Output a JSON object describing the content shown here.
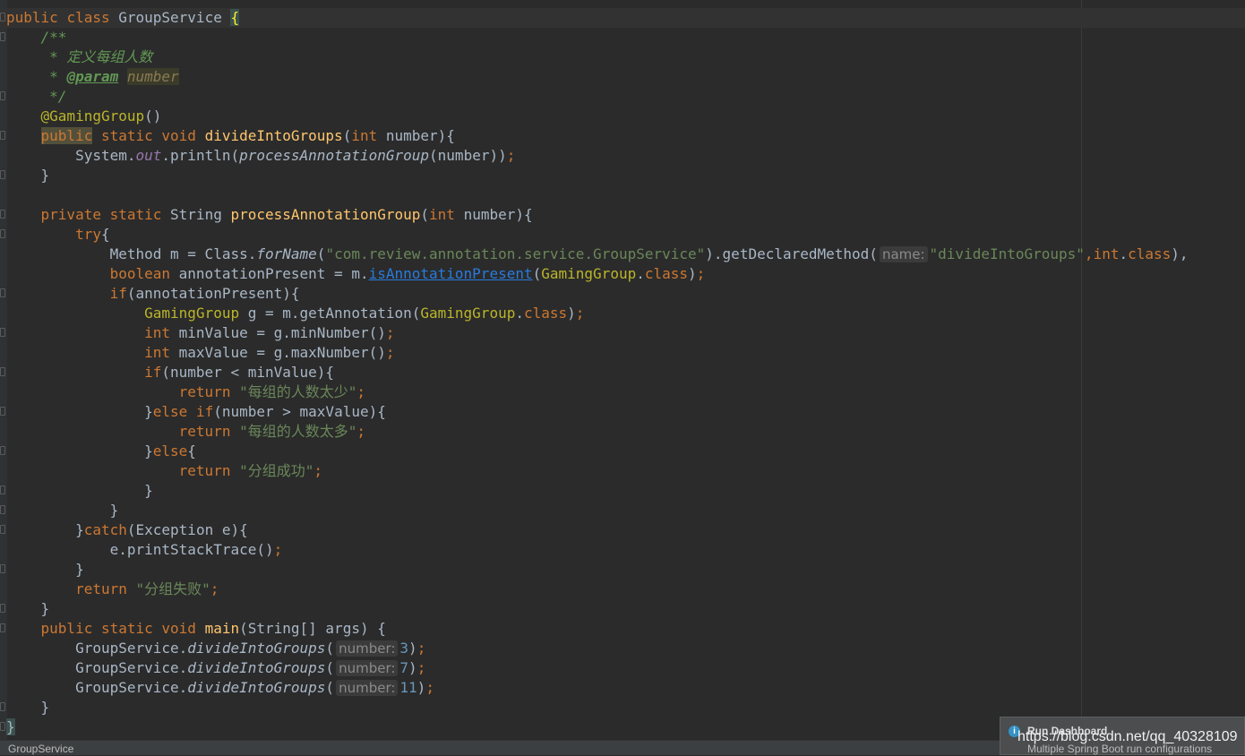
{
  "editor": {
    "lines": [
      {
        "tokens": [
          [
            "kw",
            "public "
          ],
          [
            "kw",
            "class "
          ],
          [
            "",
            "GroupService "
          ],
          [
            "brace-hl",
            "{"
          ]
        ]
      },
      {
        "tokens": [
          [
            "cmt",
            "    /**"
          ]
        ]
      },
      {
        "tokens": [
          [
            "cmt",
            "     * 定义每组人数"
          ]
        ]
      },
      {
        "tokens": [
          [
            "cmt",
            "     * "
          ],
          [
            "tag",
            "@param"
          ],
          [
            "cmt",
            " "
          ],
          [
            "tagval",
            "number"
          ]
        ]
      },
      {
        "tokens": [
          [
            "cmt",
            "     */"
          ]
        ]
      },
      {
        "tokens": [
          [
            "ann",
            "    @GamingGroup"
          ],
          [
            "",
            "()"
          ]
        ]
      },
      {
        "tokens": [
          [
            "",
            "    "
          ],
          [
            "kwhl",
            "public"
          ],
          [
            "kw",
            " static void "
          ],
          [
            "mth",
            "divideIntoGroups"
          ],
          [
            "",
            "("
          ],
          [
            "kw",
            "int "
          ],
          [
            "",
            "number){"
          ]
        ]
      },
      {
        "tokens": [
          [
            "",
            "        System."
          ],
          [
            "fld",
            "out"
          ],
          [
            "",
            ".println("
          ],
          [
            "ital",
            "processAnnotationGroup"
          ],
          [
            "",
            "(number))"
          ],
          [
            "kw",
            ";"
          ]
        ]
      },
      {
        "tokens": [
          [
            "",
            "    }"
          ]
        ]
      },
      {
        "tokens": [
          [
            "",
            ""
          ]
        ]
      },
      {
        "tokens": [
          [
            "kw",
            "    private static "
          ],
          [
            "",
            "String "
          ],
          [
            "mth",
            "processAnnotationGroup"
          ],
          [
            "",
            "("
          ],
          [
            "kw",
            "int "
          ],
          [
            "",
            "number){"
          ]
        ]
      },
      {
        "tokens": [
          [
            "kw",
            "        try"
          ],
          [
            "",
            "{"
          ]
        ]
      },
      {
        "tokens": [
          [
            "",
            "            Method m = Class."
          ],
          [
            "ital",
            "forName"
          ],
          [
            "",
            "("
          ],
          [
            "str",
            "\"com.review.annotation.service.GroupService\""
          ],
          [
            "",
            ").getDeclaredMethod("
          ],
          [
            "hint",
            "name:"
          ],
          [
            "str",
            "\"divideIntoGroups\""
          ],
          [
            "kw",
            ","
          ],
          [
            "kw",
            "int"
          ],
          [
            "",
            "."
          ],
          [
            "kw",
            "class"
          ],
          [
            "",
            "),"
          ]
        ]
      },
      {
        "tokens": [
          [
            "kw",
            "            boolean "
          ],
          [
            "",
            "annotationPresent = m."
          ],
          [
            "link",
            "isAnnotationPresent"
          ],
          [
            "",
            "("
          ],
          [
            "ann",
            "GamingGroup"
          ],
          [
            "",
            "."
          ],
          [
            "kw",
            "class"
          ],
          [
            "",
            ")"
          ],
          [
            "kw",
            ";"
          ]
        ]
      },
      {
        "tokens": [
          [
            "kw",
            "            if"
          ],
          [
            "",
            "(annotationPresent){"
          ]
        ]
      },
      {
        "tokens": [
          [
            "ann",
            "                GamingGroup "
          ],
          [
            "",
            "g = m.getAnnotation("
          ],
          [
            "ann",
            "GamingGroup"
          ],
          [
            "",
            "."
          ],
          [
            "kw",
            "class"
          ],
          [
            "",
            ")"
          ],
          [
            "kw",
            ";"
          ]
        ]
      },
      {
        "tokens": [
          [
            "kw",
            "                int "
          ],
          [
            "",
            "minValue = g.minNumber()"
          ],
          [
            "kw",
            ";"
          ]
        ]
      },
      {
        "tokens": [
          [
            "kw",
            "                int "
          ],
          [
            "",
            "maxValue = g.maxNumber()"
          ],
          [
            "kw",
            ";"
          ]
        ]
      },
      {
        "tokens": [
          [
            "kw",
            "                if"
          ],
          [
            "",
            "(number < minValue){"
          ]
        ]
      },
      {
        "tokens": [
          [
            "kw",
            "                    return "
          ],
          [
            "str",
            "\"每组的人数太少\""
          ],
          [
            "kw",
            ";"
          ]
        ]
      },
      {
        "tokens": [
          [
            "",
            "                }"
          ],
          [
            "kw",
            "else if"
          ],
          [
            "",
            "(number > maxValue){"
          ]
        ]
      },
      {
        "tokens": [
          [
            "kw",
            "                    return "
          ],
          [
            "str",
            "\"每组的人数太多\""
          ],
          [
            "kw",
            ";"
          ]
        ]
      },
      {
        "tokens": [
          [
            "",
            "                }"
          ],
          [
            "kw",
            "else"
          ],
          [
            "",
            "{"
          ]
        ]
      },
      {
        "tokens": [
          [
            "kw",
            "                    return "
          ],
          [
            "str",
            "\"分组成功\""
          ],
          [
            "kw",
            ";"
          ]
        ]
      },
      {
        "tokens": [
          [
            "",
            "                }"
          ]
        ]
      },
      {
        "tokens": [
          [
            "",
            "            }"
          ]
        ]
      },
      {
        "tokens": [
          [
            "",
            "        }"
          ],
          [
            "kw",
            "catch"
          ],
          [
            "",
            "(Exception e){"
          ]
        ]
      },
      {
        "tokens": [
          [
            "",
            "            e.printStackTrace()"
          ],
          [
            "kw",
            ";"
          ]
        ]
      },
      {
        "tokens": [
          [
            "",
            "        }"
          ]
        ]
      },
      {
        "tokens": [
          [
            "kw",
            "        return "
          ],
          [
            "str",
            "\"分组失败\""
          ],
          [
            "kw",
            ";"
          ]
        ]
      },
      {
        "tokens": [
          [
            "",
            "    }"
          ]
        ]
      },
      {
        "tokens": [
          [
            "kw",
            "    public static void "
          ],
          [
            "mth",
            "main"
          ],
          [
            "",
            "(String[] args) {"
          ]
        ]
      },
      {
        "tokens": [
          [
            "",
            "        GroupService."
          ],
          [
            "ital",
            "divideIntoGroups"
          ],
          [
            "",
            "("
          ],
          [
            "hint",
            "number:"
          ],
          [
            "num",
            "3"
          ],
          [
            "",
            ")"
          ],
          [
            "kw",
            ";"
          ]
        ]
      },
      {
        "tokens": [
          [
            "",
            "        GroupService."
          ],
          [
            "ital",
            "divideIntoGroups"
          ],
          [
            "",
            "("
          ],
          [
            "hint",
            "number:"
          ],
          [
            "num",
            "7"
          ],
          [
            "",
            ")"
          ],
          [
            "kw",
            ";"
          ]
        ]
      },
      {
        "tokens": [
          [
            "",
            "        GroupService."
          ],
          [
            "ital",
            "divideIntoGroups"
          ],
          [
            "",
            "("
          ],
          [
            "hint",
            "number:"
          ],
          [
            "num",
            "11"
          ],
          [
            "",
            ")"
          ],
          [
            "kw",
            ";"
          ]
        ]
      },
      {
        "tokens": [
          [
            "",
            "    }"
          ]
        ]
      },
      {
        "tokens": [
          [
            "brace-hl2",
            "}"
          ]
        ]
      }
    ]
  },
  "statusbar": {
    "file": "GroupService"
  },
  "popup": {
    "info_icon": "i",
    "title": "Run Dashboard",
    "subtitle": "Multiple Spring Boot run configurations"
  },
  "watermark": "https://blog.csdn.net/qq_40328109"
}
